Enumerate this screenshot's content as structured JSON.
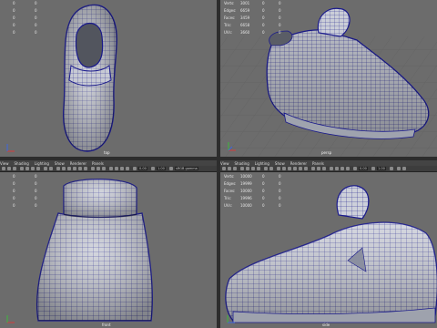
{
  "viewports": {
    "top": {
      "camera": "top",
      "hud": [
        {
          "label": "",
          "v1": "0",
          "v2": "0"
        },
        {
          "label": "",
          "v1": "0",
          "v2": "0"
        },
        {
          "label": "",
          "v1": "0",
          "v2": "0"
        },
        {
          "label": "",
          "v1": "0",
          "v2": "0"
        },
        {
          "label": "",
          "v1": "0",
          "v2": "0"
        }
      ]
    },
    "persp": {
      "camera": "persp",
      "hud": [
        {
          "label": "Verts:",
          "v1": "3001",
          "v2": "0",
          "v3": "0"
        },
        {
          "label": "Edges:",
          "v1": "6659",
          "v2": "0",
          "v3": "0"
        },
        {
          "label": "Faces:",
          "v1": "3459",
          "v2": "0",
          "v3": "0"
        },
        {
          "label": "Tris:",
          "v1": "6658",
          "v2": "0",
          "v3": "0"
        },
        {
          "label": "UVs:",
          "v1": "3660",
          "v2": "0",
          "v3": "0"
        }
      ]
    },
    "front": {
      "camera": "front",
      "menu": [
        "View",
        "Shading",
        "Lighting",
        "Show",
        "Renderer",
        "Panels"
      ],
      "toolbar_fields": [
        "0.00",
        "1.00",
        "sRGB gamma"
      ],
      "hud": [
        {
          "label": "",
          "v1": "0",
          "v2": "0"
        },
        {
          "label": "",
          "v1": "0",
          "v2": "0"
        },
        {
          "label": "",
          "v1": "0",
          "v2": "0"
        },
        {
          "label": "",
          "v1": "0",
          "v2": "0"
        },
        {
          "label": "",
          "v1": "0",
          "v2": "0"
        }
      ]
    },
    "side": {
      "camera": "side",
      "menu": [
        "View",
        "Shading",
        "Lighting",
        "Show",
        "Renderer",
        "Panels"
      ],
      "toolbar_fields": [
        "0.00",
        "1.00"
      ],
      "hud": [
        {
          "label": "Verts:",
          "v1": "10000",
          "v2": "0",
          "v3": "0"
        },
        {
          "label": "Edges:",
          "v1": "19999",
          "v2": "0",
          "v3": "0"
        },
        {
          "label": "Faces:",
          "v1": "10000",
          "v2": "0",
          "v3": "0"
        },
        {
          "label": "Tris:",
          "v1": "19996",
          "v2": "0",
          "v3": "0"
        },
        {
          "label": "UVs:",
          "v1": "10000",
          "v2": "0",
          "v3": "0"
        }
      ]
    }
  },
  "colors": {
    "viewport_bg": "#6c6c6c",
    "wire": "#1a1a8c",
    "mesh_fill": "#c9ccd6",
    "grid": "#5a5a5a"
  }
}
